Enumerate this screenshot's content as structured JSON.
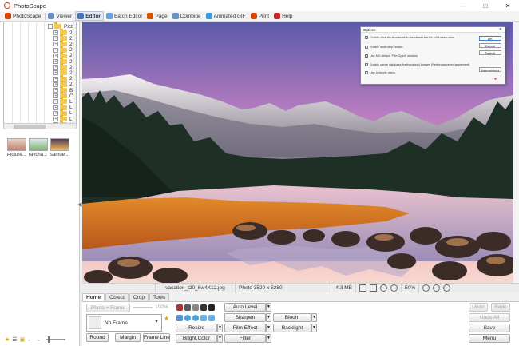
{
  "window": {
    "title": "PhotoScape"
  },
  "tabs": [
    {
      "label": "PhotoScape",
      "color": "#d9480f"
    },
    {
      "label": "Viewer",
      "color": "#6b8fc7"
    },
    {
      "label": "Editor",
      "color": "#4a74b8",
      "active": true
    },
    {
      "label": "Batch Editor",
      "color": "#6f9fd9"
    },
    {
      "label": "Page",
      "color": "#d35400"
    },
    {
      "label": "Combine",
      "color": "#6b8fc7"
    },
    {
      "label": "Animated GIF",
      "color": "#3a9bd9"
    },
    {
      "label": "Print",
      "color": "#d9480f"
    },
    {
      "label": "Help",
      "color": "#c62828"
    }
  ],
  "tree": {
    "root_label": "Pictu",
    "items": [
      "2",
      "2",
      "2",
      "2",
      "2",
      "2",
      "2",
      "2",
      "2",
      "2",
      "B",
      "C",
      "L",
      "L",
      "L",
      "L",
      "N"
    ]
  },
  "thumbnails": [
    {
      "label": "Picture...",
      "colors": [
        "#c27f6e",
        "#e7d4c8"
      ]
    },
    {
      "label": "raycha...",
      "colors": [
        "#7fb36e",
        "#dce9f3"
      ]
    },
    {
      "label": "samuel...",
      "colors": [
        "#f2b85a",
        "#4e3b55"
      ]
    }
  ],
  "options_dialog": {
    "title": "Options",
    "options": [
      {
        "label": "Double-click the thumbnail in the viewer tab for full screen view",
        "checked": true
      },
      {
        "label": "Enable multi-step resizer",
        "checked": false
      },
      {
        "label": "Use MS default \"File Open\" window",
        "checked": true
      },
      {
        "label": "Enable cache database for thumbnail images (Performance enhancement)",
        "checked": true
      },
      {
        "label": "Use Unicode menu",
        "checked": false
      }
    ],
    "buttons": {
      "ok": "OK",
      "cancel": "Cancel",
      "default": "Default",
      "associations": "Associations"
    }
  },
  "status": {
    "filename": "vacation_t20_6w4X12.jpg",
    "dimensions": "Photo 3520 x 5280",
    "filesize": "4.3 MB",
    "zoom": "50%"
  },
  "editor_tabs": [
    "Home",
    "Object",
    "Crop",
    "Tools"
  ],
  "editor": {
    "photo_frame_label": "Photo + Frame",
    "frame_zoom": "100%",
    "frame_select_value": "No Frame",
    "round_label": "Round",
    "margin_label": "Margin",
    "frame_line_label": "Frame Line",
    "resize_label": "Resize",
    "bright_color_label": "Bright,Color",
    "auto_level_label": "Auto Level",
    "sharpen_label": "Sharpen",
    "film_effect_label": "Film Effect",
    "filter_label": "Filter",
    "bloom_label": "Bloom",
    "backlight_label": "Backlight",
    "undo_label": "Undo",
    "redo_label": "Redo",
    "undo_all_label": "Undo All",
    "save_label": "Save",
    "menu_label": "Menu"
  }
}
